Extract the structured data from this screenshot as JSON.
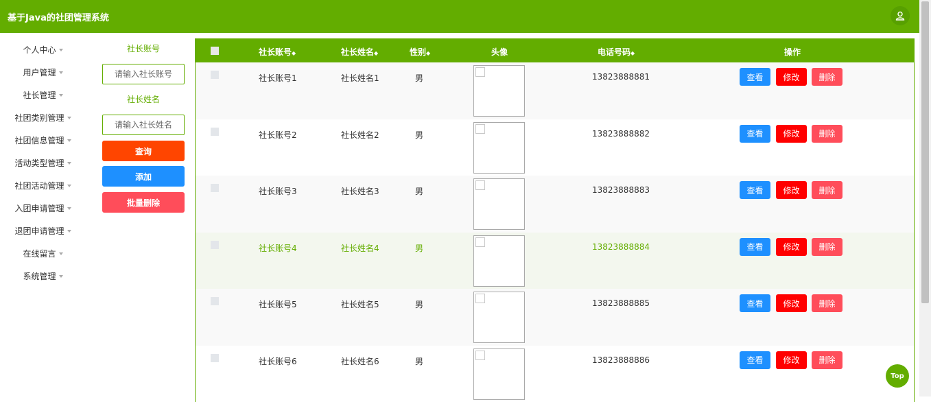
{
  "app": {
    "title": "基于Java的社团管理系统"
  },
  "sidebar": {
    "items": [
      {
        "label": "个人中心"
      },
      {
        "label": "用户管理"
      },
      {
        "label": "社长管理"
      },
      {
        "label": "社团类别管理"
      },
      {
        "label": "社团信息管理"
      },
      {
        "label": "活动类型管理"
      },
      {
        "label": "社团活动管理"
      },
      {
        "label": "入团申请管理"
      },
      {
        "label": "退团申请管理"
      },
      {
        "label": "在线留言"
      },
      {
        "label": "系统管理"
      }
    ]
  },
  "search": {
    "account_label": "社长账号",
    "account_placeholder": "请输入社长账号",
    "name_label": "社长姓名",
    "name_placeholder": "请输入社长姓名",
    "query_label": "查询",
    "add_label": "添加",
    "batch_delete_label": "批量删除"
  },
  "table": {
    "headers": {
      "account": "社长账号",
      "name": "社长姓名",
      "gender": "性别",
      "avatar": "头像",
      "phone": "电话号码",
      "actions": "操作"
    },
    "sort_icon": "◆",
    "actions": {
      "view": "查看",
      "edit": "修改",
      "delete": "删除"
    },
    "rows": [
      {
        "account": "社长账号1",
        "name": "社长姓名1",
        "gender": "男",
        "phone": "13823888881"
      },
      {
        "account": "社长账号2",
        "name": "社长姓名2",
        "gender": "男",
        "phone": "13823888882"
      },
      {
        "account": "社长账号3",
        "name": "社长姓名3",
        "gender": "男",
        "phone": "13823888883"
      },
      {
        "account": "社长账号4",
        "name": "社长姓名4",
        "gender": "男",
        "phone": "13823888884"
      },
      {
        "account": "社长账号5",
        "name": "社长姓名5",
        "gender": "男",
        "phone": "13823888885"
      },
      {
        "account": "社长账号6",
        "name": "社长姓名6",
        "gender": "男",
        "phone": "13823888886"
      }
    ]
  },
  "top_button": {
    "label": "Top"
  },
  "colors": {
    "primary": "#63ad00",
    "query": "#ff4500",
    "add": "#1e90ff",
    "batch_delete": "#ff4d5a",
    "view": "#1e90ff",
    "edit": "#ff0000",
    "delete": "#ff4d5a",
    "row_alt": "#f9f9f9",
    "row_highlight": "#f3f7ee"
  }
}
